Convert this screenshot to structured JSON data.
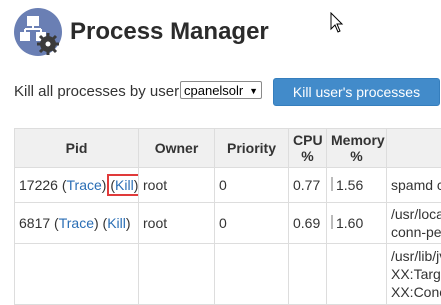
{
  "header": {
    "title": "Process Manager",
    "logo_icon": "process-gear-icon"
  },
  "kill_by_user": {
    "label": "Kill all processes by user:",
    "selected_user": "cpanelsolr",
    "button_label": "Kill user's processes"
  },
  "table": {
    "headers": {
      "pid": "Pid",
      "owner": "Owner",
      "priority": "Priority",
      "cpu_line1": "CPU",
      "cpu_line2": "%",
      "memory_line1": "Memory",
      "memory_line2": "%"
    },
    "rows": [
      {
        "pid": "17226",
        "trace": "Trace",
        "kill": "Kill",
        "owner": "root",
        "priority": "0",
        "cpu": "0.77",
        "memory": "1.56",
        "command_lines": [
          "spamd ch"
        ]
      },
      {
        "pid": "6817",
        "trace": "Trace",
        "kill": "Kill",
        "owner": "root",
        "priority": "0",
        "cpu": "0.69",
        "memory": "1.60",
        "command_lines": [
          "/usr/local",
          "conn-per-"
        ]
      },
      {
        "pid": "",
        "trace": "",
        "kill": "",
        "owner": "",
        "priority": "",
        "cpu": "",
        "memory": "",
        "command_lines": [
          "/usr/lib/jv",
          "XX:Target",
          "XX:ConcG"
        ]
      }
    ]
  },
  "colors": {
    "button": "#428bca",
    "link": "#2a6eb5",
    "highlight": "#e03a3a",
    "logo": "#6a7fb4"
  }
}
